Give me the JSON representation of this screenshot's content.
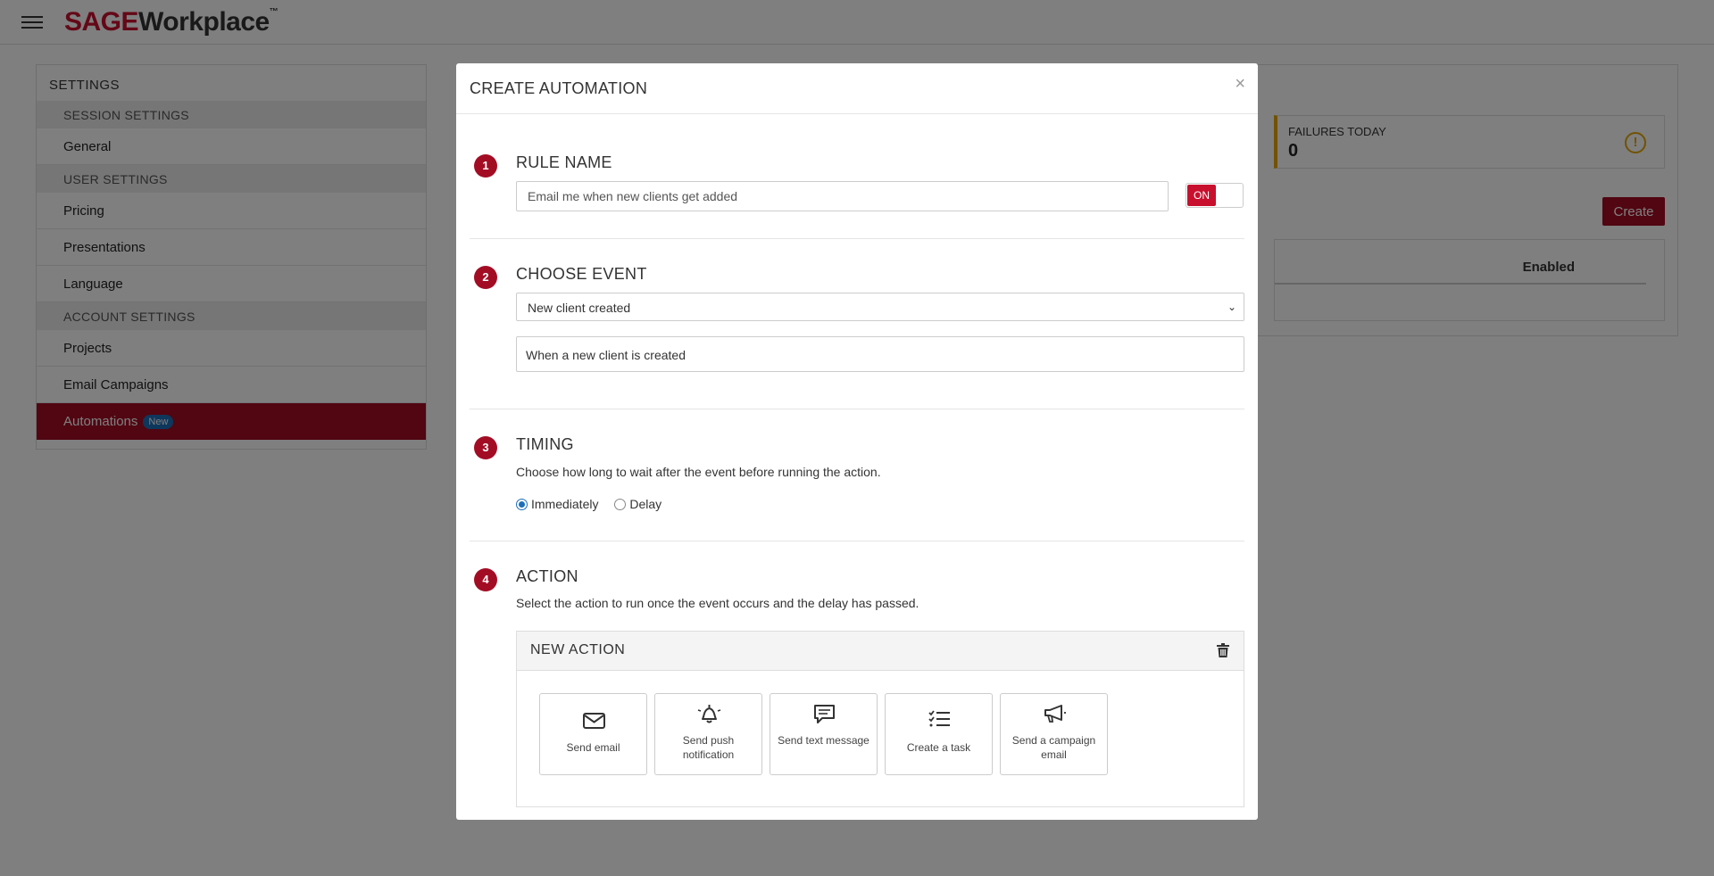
{
  "brand": {
    "sage": "SAGE",
    "workplace": "Workplace",
    "tm": "™"
  },
  "settings": {
    "title": "SETTINGS",
    "sections": [
      {
        "label": "SESSION SETTINGS",
        "items": [
          {
            "label": "General"
          }
        ]
      },
      {
        "label": "USER SETTINGS",
        "items": [
          {
            "label": "Pricing"
          },
          {
            "label": "Presentations"
          },
          {
            "label": "Language"
          }
        ]
      },
      {
        "label": "ACCOUNT SETTINGS",
        "items": [
          {
            "label": "Projects"
          },
          {
            "label": "Email Campaigns"
          },
          {
            "label": "Automations",
            "badge": "New",
            "active": true
          }
        ]
      }
    ]
  },
  "background_panel": {
    "failures_label": "FAILURES TODAY",
    "failures_value": "0",
    "create_label": "Create",
    "enabled_header": "Enabled"
  },
  "modal": {
    "title": "CREATE AUTOMATION",
    "close": "×",
    "step1": {
      "num": "1",
      "title": "RULE NAME",
      "value": "Email me when new clients get added",
      "toggle": "ON"
    },
    "step2": {
      "num": "2",
      "title": "CHOOSE EVENT",
      "selected": "New client created",
      "description": "When a new client is created"
    },
    "step3": {
      "num": "3",
      "title": "TIMING",
      "description": "Choose how long to wait after the event before running the action.",
      "options": [
        {
          "label": "Immediately",
          "checked": true
        },
        {
          "label": "Delay",
          "checked": false
        }
      ]
    },
    "step4": {
      "num": "4",
      "title": "ACTION",
      "description": "Select the action to run once the event occurs and the delay has passed.",
      "panel_title": "NEW ACTION",
      "actions": [
        {
          "label": "Send email",
          "icon": "envelope-icon"
        },
        {
          "label": "Send push notification",
          "icon": "bell-icon"
        },
        {
          "label": "Send text message",
          "icon": "chat-icon"
        },
        {
          "label": "Create a task",
          "icon": "checklist-icon"
        },
        {
          "label": "Send a campaign email",
          "icon": "megaphone-icon"
        }
      ]
    }
  },
  "colors": {
    "brand_red": "#c8102e",
    "active_red": "#a30d24",
    "accent_blue": "#1c6fb8",
    "warning": "#e5a500"
  }
}
